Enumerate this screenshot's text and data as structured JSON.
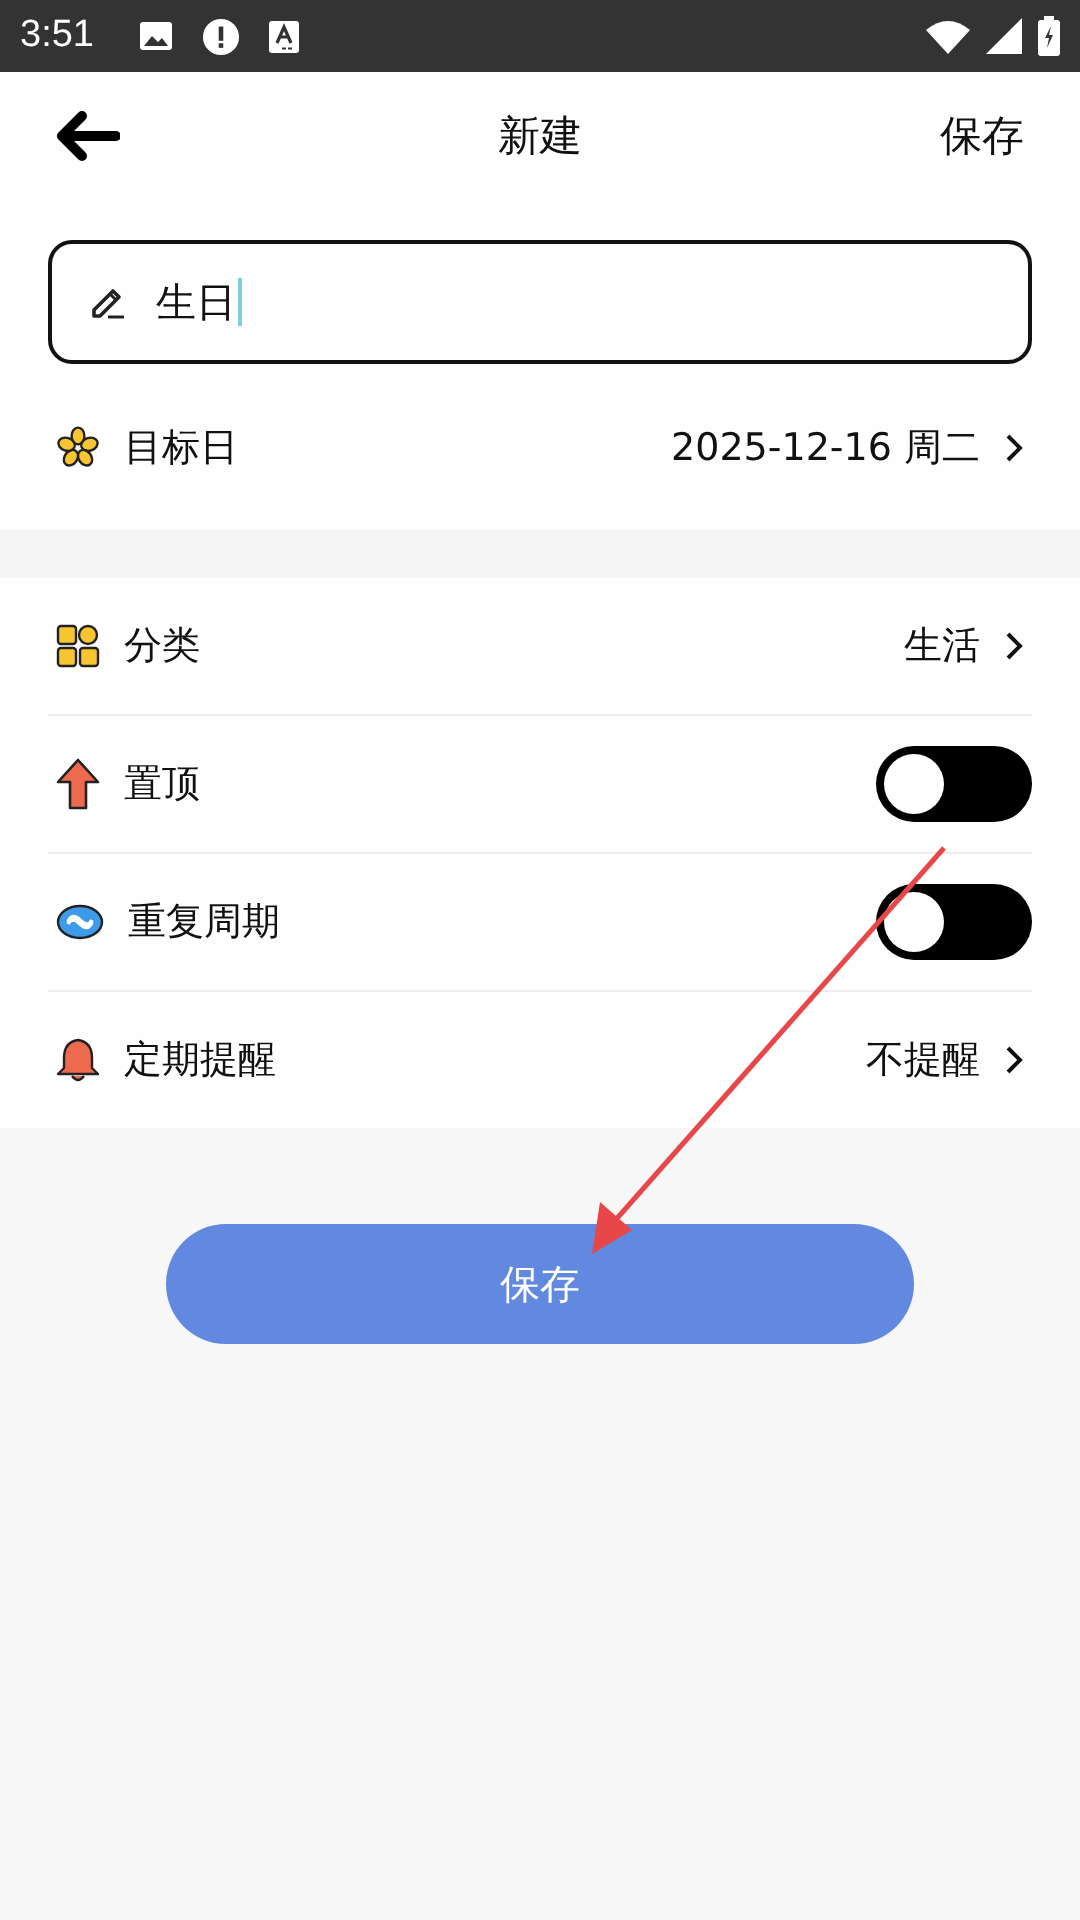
{
  "status_bar": {
    "time": "3:51"
  },
  "header": {
    "title": "新建",
    "action": "保存"
  },
  "name_field": {
    "value": "生日"
  },
  "target_date": {
    "label": "目标日",
    "value": "2025-12-16 周二"
  },
  "settings": [
    {
      "kind": "link",
      "label": "分类",
      "value": "生活"
    },
    {
      "kind": "switch",
      "label": "置顶",
      "on": false
    },
    {
      "kind": "switch",
      "label": "重复周期",
      "on": false
    },
    {
      "kind": "link",
      "label": "定期提醒",
      "value": "不提醒"
    }
  ],
  "save_button": "保存"
}
